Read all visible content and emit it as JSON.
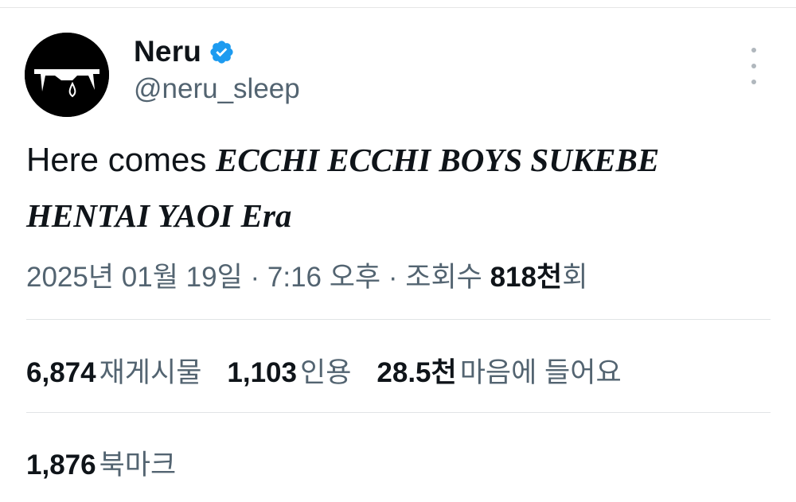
{
  "author": {
    "display_name": "Neru",
    "handle": "@neru_sleep",
    "verified": true,
    "verified_color": "#1d9bf0",
    "avatar_icon": "avatar-black-circle-white-drip-mouth"
  },
  "tweet": {
    "text_plain": "Here comes",
    "text_emphasis": "ECCHI ECCHI BOYS SUKEBE HENTAI YAOI Era"
  },
  "meta": {
    "date": "2025년 01월 19일",
    "sep1": " · ",
    "time": "7:16 오후",
    "sep2": " · ",
    "views_label": "조회수",
    "views_count": "818천",
    "views_suffix": "회"
  },
  "stats": {
    "reposts": {
      "count": "6,874",
      "label": "재게시물"
    },
    "quotes": {
      "count": "1,103",
      "label": "인용"
    },
    "likes": {
      "count": "28.5천",
      "label": "마음에 들어요"
    }
  },
  "bookmarks": {
    "count": "1,876",
    "label": "북마크"
  },
  "colors": {
    "text_primary": "#0f1419",
    "text_secondary": "#536471",
    "divider": "#e1e4e6"
  }
}
